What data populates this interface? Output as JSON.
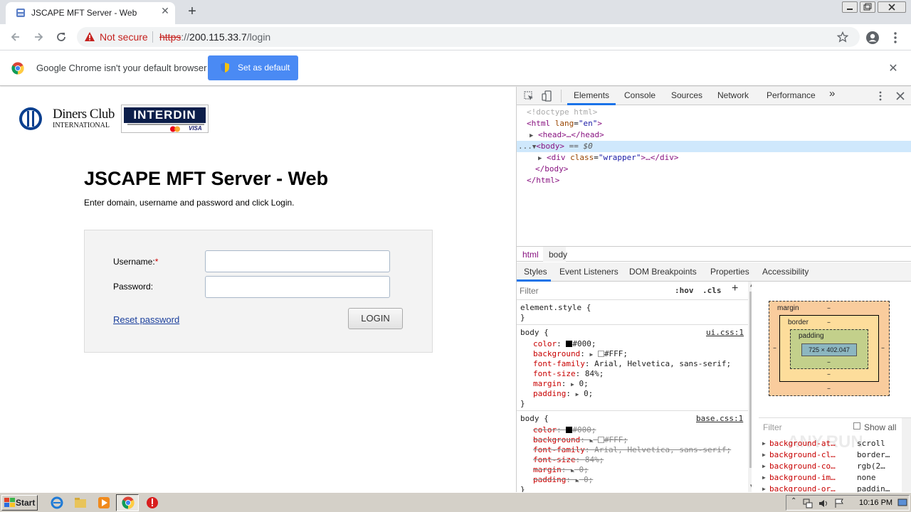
{
  "browser": {
    "tab_title": "JSCAPE MFT Server - Web",
    "tab_close": "✕",
    "new_tab": "+",
    "not_secure": "Not secure",
    "url_scheme": "https",
    "url_rest": "://",
    "url_host": "200.115.33.7",
    "url_path": "/login",
    "infobar_text": "Google Chrome isn't your default browser",
    "set_default_label": "Set as default",
    "infobar_close": "✕"
  },
  "page": {
    "logo_diners_line1": "Diners Club",
    "logo_diners_line2": "INTERNATIONAL",
    "logo_interdin": "INTERDIN",
    "logo_interdin_visa": "VISA",
    "title": "JSCAPE MFT Server - Web",
    "subtitle": "Enter domain, username and password and click Login.",
    "username_label": "Username:",
    "required_mark": "*",
    "password_label": "Password:",
    "username_value": "",
    "password_value": "",
    "reset_link": "Reset password",
    "login_button": "LOGIN"
  },
  "devtools": {
    "tabs": [
      "Elements",
      "Console",
      "Sources",
      "Network",
      "Performance"
    ],
    "more_tabs": "»",
    "dom": {
      "doctype": "<!doctype html>",
      "html_open": "<html",
      "lang_attr": "lang",
      "lang_val": "\"en\"",
      "head": "<head>…</head>",
      "body_open": "<body>",
      "body_marker": "== $0",
      "div_open": "<div",
      "class_attr": "class",
      "class_val": "\"wrapper\"",
      "div_rest": ">…</div>",
      "body_close": "</body>",
      "html_close": "</html>",
      "ellipsis": "..."
    },
    "breadcrumbs": [
      "html",
      "body"
    ],
    "subtabs": [
      "Styles",
      "Event Listeners",
      "DOM Breakpoints",
      "Properties",
      "Accessibility"
    ],
    "filter_placeholder": "Filter",
    "hov": ":hov",
    "cls": ".cls",
    "plus": "+",
    "element_style": "element.style {",
    "close_brace": "}",
    "rule1": {
      "selector": "body {",
      "source": "ui.css:1",
      "props": [
        {
          "name": "color",
          "value": "#000;"
        },
        {
          "name": "background",
          "value": "#FFF;"
        },
        {
          "name": "font-family",
          "value": "Arial, Helvetica, sans-serif;"
        },
        {
          "name": "font-size",
          "value": "84%;"
        },
        {
          "name": "margin",
          "value": "0;"
        },
        {
          "name": "padding",
          "value": "0;"
        }
      ]
    },
    "rule2": {
      "selector": "body {",
      "source": "base.css:1",
      "props": [
        {
          "name": "color",
          "value": "#000;"
        },
        {
          "name": "background",
          "value": "#FFF;"
        },
        {
          "name": "font-family",
          "value": "Arial, Helvetica, sans-serif;"
        },
        {
          "name": "font-size",
          "value": "84%;"
        },
        {
          "name": "margin",
          "value": "0;"
        },
        {
          "name": "padding",
          "value": "0;"
        }
      ],
      "last": "}"
    },
    "boxmodel": {
      "margin": "margin",
      "border": "border",
      "padding": "padding",
      "dash": "–",
      "content": "725 × 402.047"
    },
    "computed_filter": "Filter",
    "show_all": "Show all",
    "computed": [
      {
        "key": "background-at…",
        "value": "scroll"
      },
      {
        "key": "background-cl…",
        "value": "border…"
      },
      {
        "key": "background-co…",
        "value": "rgb(2…"
      },
      {
        "key": "background-im…",
        "value": "none"
      },
      {
        "key": "background-or…",
        "value": "paddin…"
      }
    ],
    "watermark": "ANY.RUN"
  },
  "taskbar": {
    "start": "Start",
    "clock": "10:16 PM"
  }
}
